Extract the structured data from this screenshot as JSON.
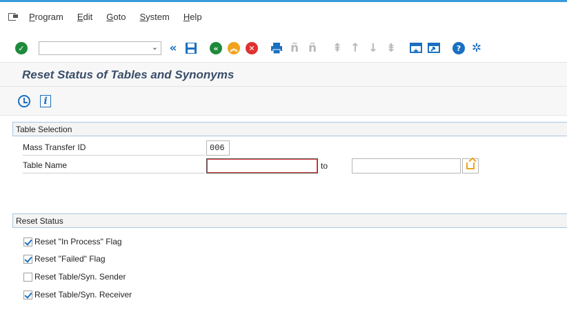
{
  "menu": {
    "items": [
      {
        "label": "Program",
        "ul": "P",
        "rest": "rogram"
      },
      {
        "label": "Edit",
        "ul": "E",
        "rest": "dit"
      },
      {
        "label": "Goto",
        "ul": "G",
        "rest": "oto"
      },
      {
        "label": "System",
        "ul": "S",
        "rest": "ystem"
      },
      {
        "label": "Help",
        "ul": "H",
        "rest": "elp"
      }
    ]
  },
  "toolbar": {
    "command_field_value": "",
    "icons": [
      "enter-icon",
      "save-icon",
      "back-icon",
      "exit-icon",
      "cancel-icon",
      "print-icon",
      "find-icon",
      "find-next-icon",
      "first-page-icon",
      "previous-page-icon",
      "next-page-icon",
      "last-page-icon",
      "new-session-icon",
      "shortcut-icon",
      "help-icon",
      "settings-icon"
    ]
  },
  "page": {
    "title": "Reset Status of Tables and Synonyms"
  },
  "table_selection": {
    "header": "Table Selection",
    "mass_transfer_label": "Mass Transfer ID",
    "mass_transfer_value": "006",
    "table_name_label": "Table Name",
    "table_name_from": "",
    "to_label": "to",
    "table_name_to": ""
  },
  "reset_status": {
    "header": "Reset Status",
    "options": [
      {
        "label": "Reset \"In Process\" Flag",
        "checked": true
      },
      {
        "label": "Reset \"Failed\" Flag",
        "checked": true
      },
      {
        "label": "Reset Table/Syn. Sender",
        "checked": false
      },
      {
        "label": "Reset Table/Syn. Receiver",
        "checked": true
      }
    ]
  },
  "colors": {
    "accent": "#3a9ad9",
    "title": "#3a4e6a",
    "green": "#1e8a3c",
    "orange": "#f0a31a",
    "red": "#e03030",
    "blue": "#1a6fc0"
  }
}
